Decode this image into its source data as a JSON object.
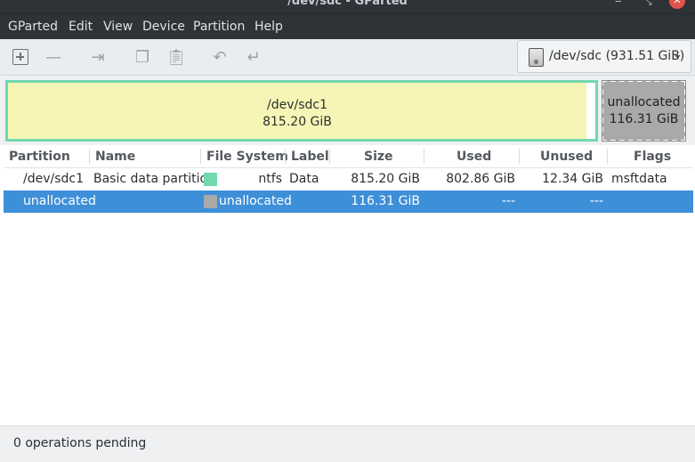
{
  "window": {
    "title": "/dev/sdc - GParted",
    "min_icon": "minimize-icon",
    "max_icon": "maximize-icon",
    "close_icon": "close-icon"
  },
  "menubar": {
    "items": [
      "GParted",
      "Edit",
      "View",
      "Device",
      "Partition",
      "Help"
    ]
  },
  "toolbar": {
    "icons": [
      "new-partition-icon",
      "delete-partition-icon",
      "resize-move-icon",
      "copy-icon",
      "paste-icon",
      "undo-icon",
      "apply-icon"
    ]
  },
  "device_selector": {
    "device": "/dev/sdc",
    "size": "(931.51 GiB)",
    "icon": "harddisk-icon"
  },
  "disk_map": {
    "partition": {
      "name": "/dev/sdc1",
      "size": "815.20 GiB",
      "color": "#72d8ad",
      "fill": "#f7f5b5"
    },
    "unallocated": {
      "name": "unallocated",
      "size": "116.31 GiB",
      "color": "#a9a9a9"
    }
  },
  "table": {
    "headers": [
      "Partition",
      "Name",
      "File System",
      "Label",
      "Size",
      "Used",
      "Unused",
      "Flags"
    ],
    "rows": [
      {
        "partition": "/dev/sdc1",
        "name": "Basic data partition",
        "fs_color": "#72d8ad",
        "filesystem": "ntfs",
        "label": "Data",
        "size": "815.20 GiB",
        "used": "802.86 GiB",
        "unused": "12.34 GiB",
        "flags": "msftdata"
      },
      {
        "partition": "unallocated",
        "name": "",
        "fs_color": "#a9a9a9",
        "filesystem": "unallocated",
        "label": "",
        "size": "116.31 GiB",
        "used": "---",
        "unused": "---",
        "flags": ""
      }
    ]
  },
  "status": {
    "text": "0 operations pending"
  },
  "colors": {
    "selection": "#3d8fd8",
    "menubar": "#2f3237"
  }
}
